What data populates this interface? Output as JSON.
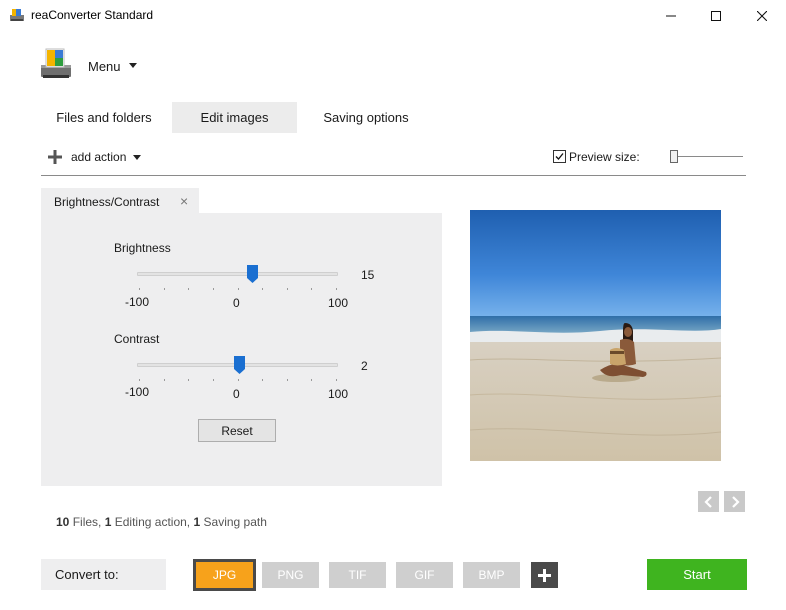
{
  "window": {
    "title": "reaConverter Standard"
  },
  "menu": {
    "label": "Menu"
  },
  "tabs": [
    {
      "label": "Files and folders"
    },
    {
      "label": "Edit images"
    },
    {
      "label": "Saving options"
    }
  ],
  "toolbar": {
    "add_action": "add action",
    "preview_size_label": "Preview size:",
    "preview_checked": true
  },
  "action": {
    "tab_label": "Brightness/Contrast",
    "close_glyph": "×",
    "brightness": {
      "title": "Brightness",
      "min": -100,
      "max": 100,
      "value": 15,
      "min_label": "-100",
      "mid_label": "0",
      "max_label": "100",
      "value_label": "15"
    },
    "contrast": {
      "title": "Contrast",
      "min": -100,
      "max": 100,
      "value": 2,
      "min_label": "-100",
      "mid_label": "0",
      "max_label": "100",
      "value_label": "2"
    },
    "reset_label": "Reset"
  },
  "summary": {
    "files_count": "10",
    "files_label": "Files,",
    "actions_count": "1",
    "actions_label": "Editing action,",
    "paths_count": "1",
    "paths_label": "Saving path"
  },
  "bottom": {
    "convert_to": "Convert to:",
    "formats": [
      "JPG",
      "PNG",
      "TIF",
      "GIF",
      "BMP"
    ],
    "selected_format": "JPG",
    "start_label": "Start"
  },
  "colors": {
    "accent_orange": "#f7a21b",
    "start_green": "#3fb41f",
    "slider_blue": "#1a6fd1"
  }
}
